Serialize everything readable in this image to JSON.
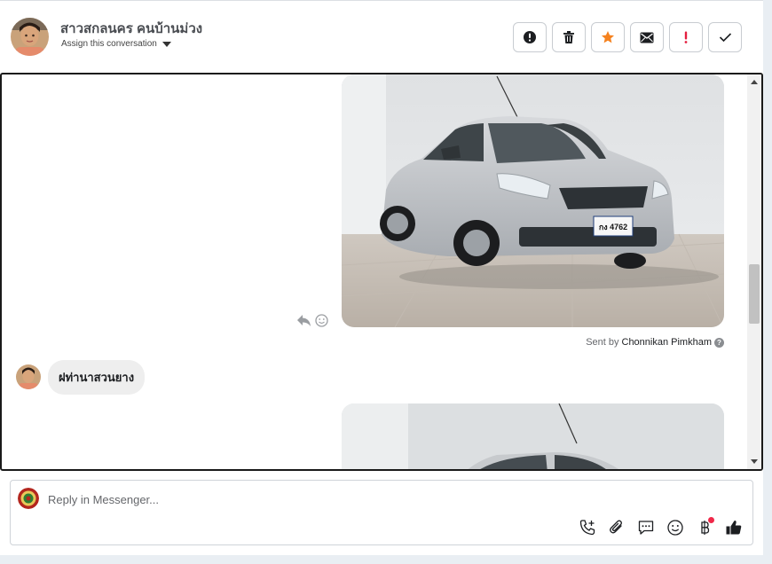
{
  "contact": {
    "name": "สาวสกลนคร คนบ้านม่วง",
    "assign_label": "Assign this conversation"
  },
  "actions": [
    {
      "name": "report-button",
      "icon": "alert-circle-icon"
    },
    {
      "name": "delete-button",
      "icon": "trash-icon"
    },
    {
      "name": "star-button",
      "icon": "star-icon",
      "color": "#f5821f"
    },
    {
      "name": "mark-unread-button",
      "icon": "envelope-icon"
    },
    {
      "name": "important-button",
      "icon": "exclamation-icon",
      "color": "#e41e3f"
    },
    {
      "name": "done-button",
      "icon": "check-icon"
    }
  ],
  "messages": {
    "sent_by_prefix": "Sent by",
    "sent_by_agent": "Chonnikan Pimkham",
    "incoming_text": "ฝท่านาสวนยาง",
    "plate_text": "กง 4762"
  },
  "composer": {
    "placeholder": "Reply in Messenger..."
  },
  "colors": {
    "accent_orange": "#f5821f",
    "alert_red": "#e41e3f",
    "notification_dot": "#f02849"
  }
}
